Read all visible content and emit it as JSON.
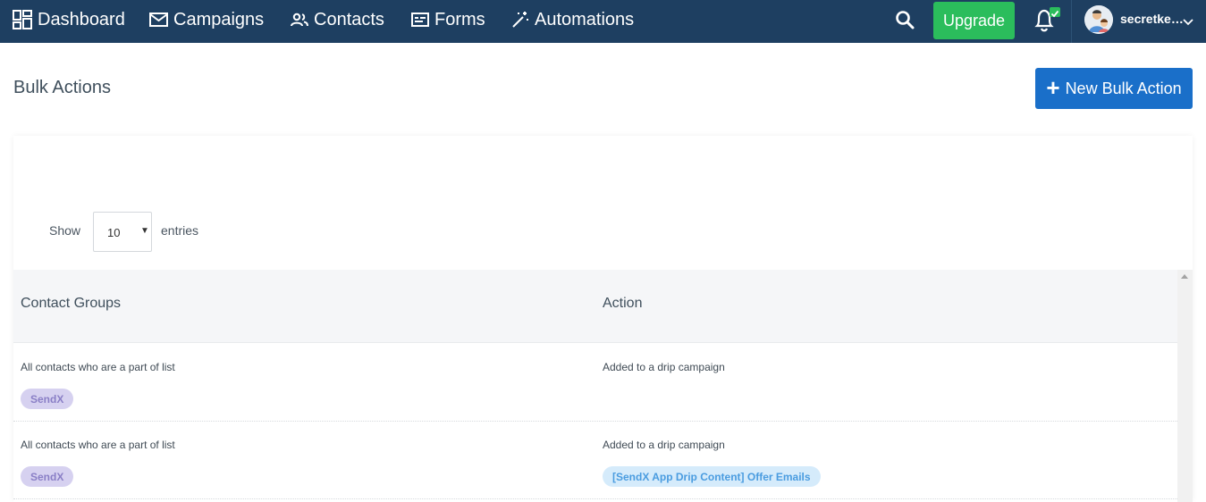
{
  "nav": {
    "items": [
      {
        "label": "Dashboard",
        "icon": "dashboard-icon"
      },
      {
        "label": "Campaigns",
        "icon": "envelope-icon"
      },
      {
        "label": "Contacts",
        "icon": "contacts-icon"
      },
      {
        "label": "Forms",
        "icon": "form-icon"
      },
      {
        "label": "Automations",
        "icon": "magic-wand-icon"
      }
    ],
    "search_icon": "search-icon",
    "upgrade_label": "Upgrade",
    "notification_icon": "bell-icon",
    "user_name": "secretkee...",
    "colors": {
      "background": "#1e3f61",
      "upgrade": "#2bbd5c"
    }
  },
  "page": {
    "title": "Bulk Actions",
    "new_button_label": "New Bulk Action",
    "new_button_color": "#1a6fc9"
  },
  "table_controls": {
    "show_label": "Show",
    "entries_value": "10",
    "entries_label": "entries"
  },
  "table": {
    "columns": [
      "Contact Groups",
      "Action"
    ],
    "rows": [
      {
        "group_text": "All contacts who are a part of list",
        "group_tag": "SendX",
        "action_text": "Added to a drip campaign",
        "action_tag": ""
      },
      {
        "group_text": "All contacts who are a part of list",
        "group_tag": "SendX",
        "action_text": "Added to a drip campaign",
        "action_tag": "[SendX App Drip Content] Offer Emails"
      }
    ]
  }
}
